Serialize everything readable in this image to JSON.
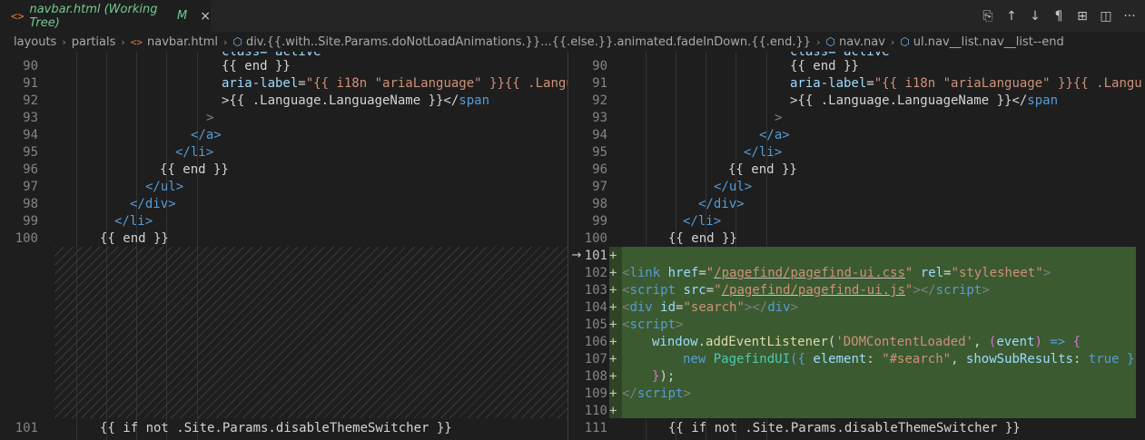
{
  "tab": {
    "icon": "<>",
    "title": "navbar.html (Working Tree)",
    "status": "M",
    "close": "×"
  },
  "actions": [
    {
      "name": "open-file-icon",
      "glyph": "⎘"
    },
    {
      "name": "previous-change-icon",
      "glyph": "↑"
    },
    {
      "name": "next-change-icon",
      "glyph": "↓"
    },
    {
      "name": "show-whitespace-icon",
      "glyph": "¶"
    },
    {
      "name": "book-icon",
      "glyph": "⊞"
    },
    {
      "name": "split-editor-icon",
      "glyph": "◫"
    },
    {
      "name": "more-actions-icon",
      "glyph": "···"
    }
  ],
  "breadcrumb": {
    "items": [
      {
        "label": "layouts"
      },
      {
        "label": "partials"
      },
      {
        "label": "navbar.html",
        "icon": "<>"
      },
      {
        "label": "div.{{.with..Site.Params.doNotLoadAnimations.}}...{{.else.}}.animated.fadeInDown.{{.end.}}",
        "sym": "⬡"
      },
      {
        "label": "nav.nav",
        "sym": "⬡"
      },
      {
        "label": "ul.nav__list.nav__list--end",
        "sym": "⬡"
      }
    ]
  },
  "left": {
    "lines": [
      {
        "n": "90",
        "row": 1,
        "html_key": "l90"
      },
      {
        "n": "91",
        "row": 2
      },
      {
        "n": "92",
        "row": 3
      },
      {
        "n": "93",
        "row": 4
      },
      {
        "n": "94",
        "row": 5
      },
      {
        "n": "95",
        "row": 6
      },
      {
        "n": "96",
        "row": 7
      },
      {
        "n": "97",
        "row": 8
      },
      {
        "n": "98",
        "row": 9
      },
      {
        "n": "99",
        "row": 10
      },
      {
        "n": "100",
        "row": 11
      },
      {
        "n": "101",
        "row": 22
      }
    ]
  },
  "right": {
    "lines": [
      {
        "n": "90"
      },
      {
        "n": "91"
      },
      {
        "n": "92"
      },
      {
        "n": "93"
      },
      {
        "n": "94"
      },
      {
        "n": "95"
      },
      {
        "n": "96"
      },
      {
        "n": "97"
      },
      {
        "n": "98"
      },
      {
        "n": "99"
      },
      {
        "n": "100"
      },
      {
        "n": "101"
      },
      {
        "n": "102"
      },
      {
        "n": "103"
      },
      {
        "n": "104"
      },
      {
        "n": "105"
      },
      {
        "n": "106"
      },
      {
        "n": "107"
      },
      {
        "n": "108"
      },
      {
        "n": "109"
      },
      {
        "n": "110"
      },
      {
        "n": "111"
      }
    ]
  },
  "code": {
    "partial_top": "class=\"active\"",
    "end": "{{ end }}",
    "aria_attr": "aria-label",
    "aria_val_a": "\"{{ i18n \"ariaLanguage\" }}{{ .Langu",
    "lang_name": ">{{ .Language.LanguageName }}</",
    "span": "span",
    "gt": ">",
    "close_a": "</a>",
    "close_li": "</li>",
    "close_ul": "</ul>",
    "close_div": "</div>",
    "if_theme": "{{ if not .Site.Params.disableThemeSwitcher }}",
    "added_link_href": "/pagefind/pagefind-ui.css",
    "added_link_rel": "stylesheet",
    "added_script_src": "/pagefind/pagefind-ui.js",
    "added_div_id": "search",
    "added_window": "window",
    "added_add_listener": "addEventListener",
    "added_event_name": "'DOMContentLoaded'",
    "added_event_param": "event",
    "added_new": "new",
    "added_class": "PagefindUI",
    "added_element_key": "element",
    "added_element_val": "\"#search\"",
    "added_sub_key": "showSubResults",
    "added_true": "true"
  },
  "gutter_marker": "+",
  "arrow": "→"
}
